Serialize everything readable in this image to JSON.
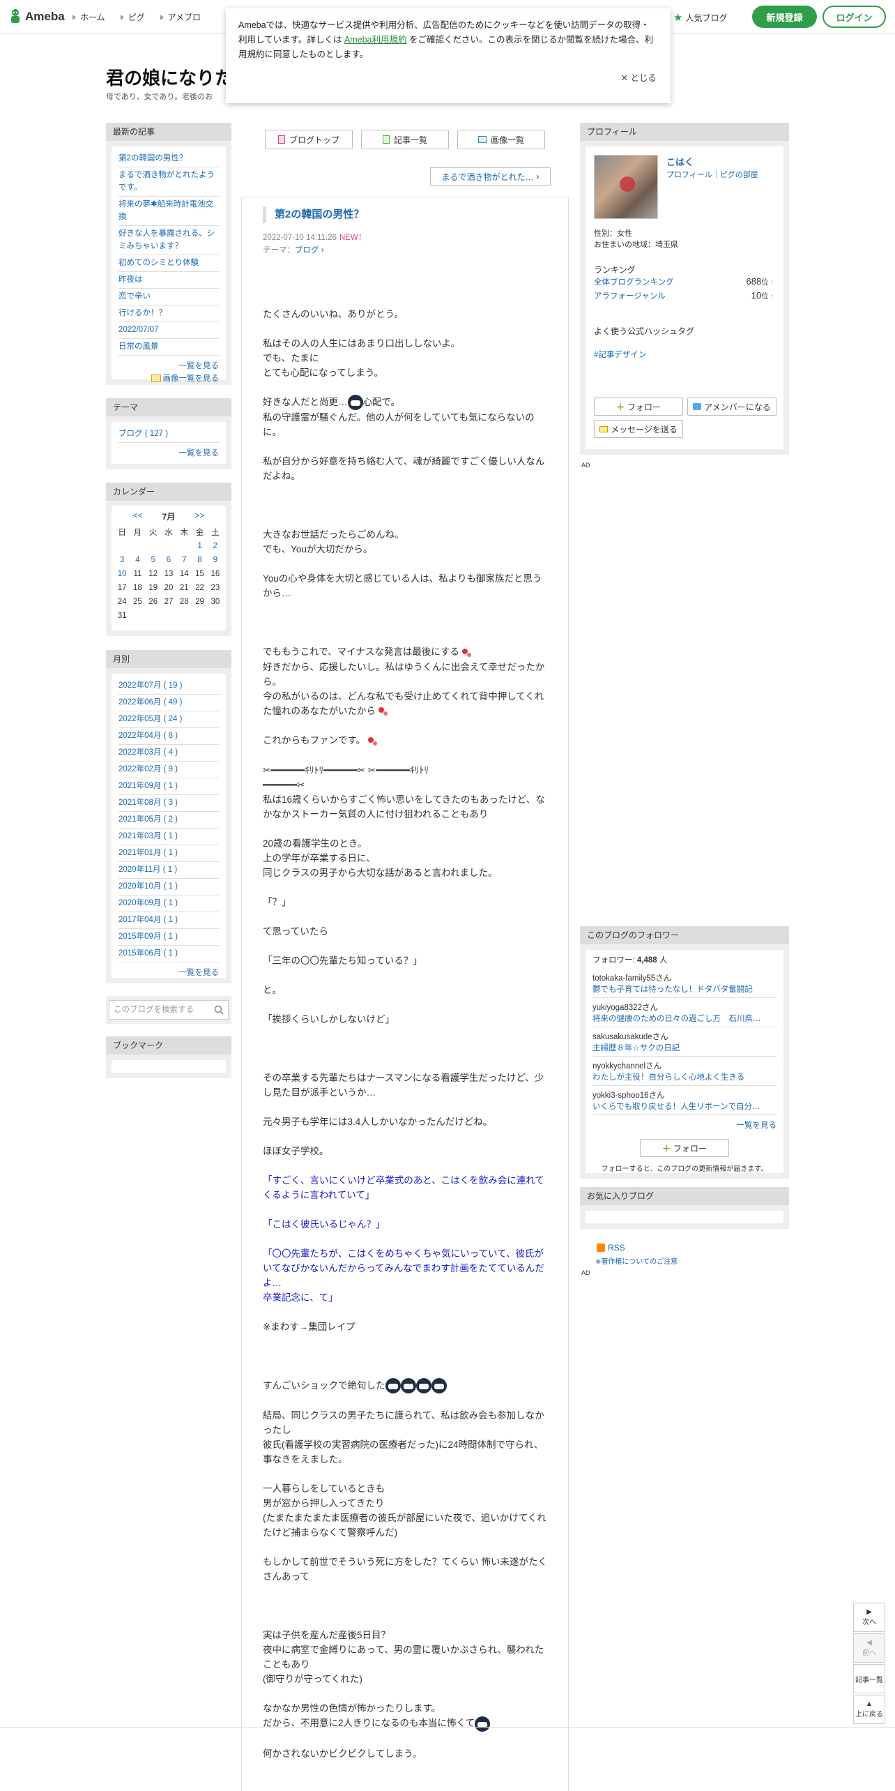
{
  "header": {
    "logo": "Ameba",
    "nav": [
      "ホーム",
      "ピグ",
      "アメプロ"
    ],
    "popular": "人気ブログ",
    "signup": "新規登録",
    "login": "ログイン"
  },
  "cookie": {
    "text1": "Amebaでは、快適なサービス提供や利用分析、広告配信のためにクッキーなどを使い訪問データの取得・利用しています。詳しくは",
    "link": "Ameba利用規約",
    "text2": "をご確認ください。この表示を閉じるか閲覧を続けた場合、利用規約に同意したものとします。",
    "close": "✕ とじる"
  },
  "blog": {
    "title": "君の娘になりた",
    "desc": "母であり、女であり。老後のお"
  },
  "tabs": {
    "top": "ブログトップ",
    "list": "記事一覧",
    "images": "画像一覧"
  },
  "next_article": "まるで洒き物がとれた…",
  "article": {
    "title": "第2の韓国の男性？",
    "date": "2022-07-10 14:11:26",
    "new": "NEW！",
    "theme_label": "テーマ：",
    "theme": "ブログ"
  },
  "latest": {
    "head": "最新の記事",
    "items": [
      "第2の韓国の男性？",
      "まるで洒き物がとれたようです。",
      "将来の夢✱船来時計電池交換",
      "好きな人を暴露される、シミみちゃいます？",
      "初めてのシミとり体験",
      "昨夜は",
      "恋で辛い",
      "行けるか！？",
      "2022/07/07",
      "日常の風景"
    ],
    "more": "一覧を見る",
    "more_images": "画像一覧を見る"
  },
  "theme_box": {
    "head": "テーマ",
    "item": "ブログ ( 127 )",
    "more": "一覧を見る"
  },
  "calendar": {
    "head": "カレンダー",
    "prev": "<<",
    "month": "7月",
    "next": ">>",
    "weekdays": [
      "日",
      "月",
      "火",
      "水",
      "木",
      "金",
      "土"
    ],
    "rows": [
      [
        "",
        "",
        "",
        "",
        "",
        "1",
        "2"
      ],
      [
        "3",
        "4",
        "5",
        "6",
        "7",
        "8",
        "9"
      ],
      [
        "10",
        "11",
        "12",
        "13",
        "14",
        "15",
        "16"
      ],
      [
        "17",
        "18",
        "19",
        "20",
        "21",
        "22",
        "23"
      ],
      [
        "24",
        "25",
        "26",
        "27",
        "28",
        "29",
        "30"
      ],
      [
        "31",
        "",
        "",
        "",
        "",
        "",
        ""
      ]
    ]
  },
  "months": {
    "head": "月別",
    "items": [
      "2022年07月 ( 19 )",
      "2022年06月 ( 49 )",
      "2022年05月 ( 24 )",
      "2022年04月 ( 8 )",
      "2022年03月 ( 4 )",
      "2022年02月 ( 9 )",
      "2021年09月 ( 1 )",
      "2021年08月 ( 3 )",
      "2021年05月 ( 2 )",
      "2021年03月 ( 1 )",
      "2021年01月 ( 1 )",
      "2020年11月 ( 1 )",
      "2020年10月 ( 1 )",
      "2020年09月 ( 1 )",
      "2017年04月 ( 1 )",
      "2015年09月 ( 1 )",
      "2015年06月 ( 1 )"
    ],
    "more": "一覧を見る"
  },
  "search": {
    "placeholder": "このブログを検索する"
  },
  "bookmark": {
    "head": "ブックマーク"
  },
  "profile": {
    "head": "プロフィール",
    "name": "こはく",
    "links": "プロフィール｜ピグの部屋",
    "gender": "性別：女性",
    "area": "お住まいの地域：埼玉県",
    "ranking_head": "ランキング",
    "rank1": "全体ブログランキング",
    "rank1_val": "688",
    "rank2": "アラフォージャンル",
    "rank2_val": "10",
    "rank_unit": "位",
    "hashtag_head": "よく使う公式ハッシュタグ",
    "hashtag": "#記事デザイン",
    "follow": "フォロー",
    "member": "アメンバーになる",
    "message": "メッセージを送る"
  },
  "ad": "AD",
  "followers": {
    "head": "このブログのフォロワー",
    "count_label": "フォロワー: ",
    "count": "4,488",
    "unit": " 人",
    "list": [
      [
        "totokaka-family55さん",
        "鬱でも子育ては待ったなし！ドタバタ奮闘記"
      ],
      [
        "yukiyoga8322さん",
        "将来の健康のための日々の過ごし方　石川県…"
      ],
      [
        "sakusakusakudeさん",
        "主婦歴８年☆サクの日記"
      ],
      [
        "nyokkychannelさん",
        "わたしが主役！自分らしく心地よく生きる"
      ],
      [
        "yokki3-sphoo16さん",
        "いくらでも取り戻せる！人生リボーンで自分…"
      ]
    ],
    "more": "一覧を見る",
    "follow": "フォロー",
    "note": "フォローすると、このブログの更新情報が届きます。"
  },
  "favorite": {
    "head": "お気に入りブログ"
  },
  "rss": {
    "label": "RSS",
    "note": "※著作権についてのご注意"
  },
  "pagebtns": {
    "next": "次へ",
    "prev": "前へ",
    "list": "記事一覧",
    "top": "上に戻る"
  },
  "body": [
    "たくさんのいいね、ありがとう。",
    "私はその人の人生にはあまり口出ししないよ。\nでも、たまに\nとても心配になってしまう。",
    "好きな人だと尚更…|E|心配で。\n私の守護霊が騒ぐんだ。他の人が何をしていても気にならないのに。",
    "私が自分から好意を持ち絡む人て、魂が綺麗ですごく優しい人なんだよね。",
    "",
    "大きなお世話だったらごめんね。\nでも、Youが大切だから。",
    "Youの心や身体を大切と感じている人は、私よりも御家族だと思うから…",
    "",
    "でももうこれで、マイナスな発言は最後にする|S|\n好きだから、応援したいし。私はゆうくんに出会えて幸せだったから。\n今の私がいるのは、どんな私でも受け止めてくれて背中押してくれた憧れのあなたがいたから|S|",
    "これからもファンです。|S|",
    "✂︎━━━━━━ｷﾘﾄﾘ━━━━━━✂︎ ✂︎━━━━━━ｷﾘﾄﾘ\n━━━━━━✂︎\n私は16歳くらいからすごく怖い思いをしてきたのもあったけど、なかなかストーカー気質の人に付け狙われることもあり",
    "20歳の看護学生のとき。\n上の学年が卒業する日に、\n同じクラスの男子から大切な話があると言われました。",
    "「？」",
    "て思っていたら",
    "「三年の〇〇先輩たち知っている？」",
    "と。",
    "「挨拶くらいしかしないけど」",
    "",
    "その卒業する先輩たちはナースマンになる看護学生だったけど、少し見た目が派手というか…",
    "元々男子も学年には3.4人しかいなかったんだけどね。",
    "ほぼ女子学校。",
    "Q|「すごく、言いにくいけど卒業式のあと、こはくを飲み会に連れてくるように言われていて」",
    "Q|「こはく彼氏いるじゃん？」",
    "Q|「〇〇先輩たちが、こはくをめちゃくちゃ気にいっていて、彼氏がいてなびかないんだからってみんなでまわす計画をたてているんだよ…\n卒業記念に、て」",
    "※まわす→集団レイプ",
    "",
    "すんごいショックで絶句した|EEEE|",
    "結局、同じクラスの男子たちに護られて、私は飲み会も参加しなかったし\n彼氏(看護学校の実習病院の医療者だった)に24時間体制で守られ、事なきをえました。",
    "一人暮らしをしているときも\n男が窓から押し入ってきたり\n(たまたまたまたま医療者の彼氏が部屋にいた夜で、追いかけてくれたけど捕まらなくて警察呼んだ)",
    "もしかして前世でそういう死に方をした？てくらい 怖い未遂がたくさんあって",
    "",
    "実は子供を産んだ産後5日目？\n夜中に病室で金縛りにあって、男の霊に覆いかぶさられ、襲われたこともあり\n(御守りが守ってくれた)",
    "なかなか男性の色情が怖かったりします。\nだから、不用意に2人きりになるのも本当に怖くて|E|",
    "何かされないかビクビクしてしまう。"
  ]
}
